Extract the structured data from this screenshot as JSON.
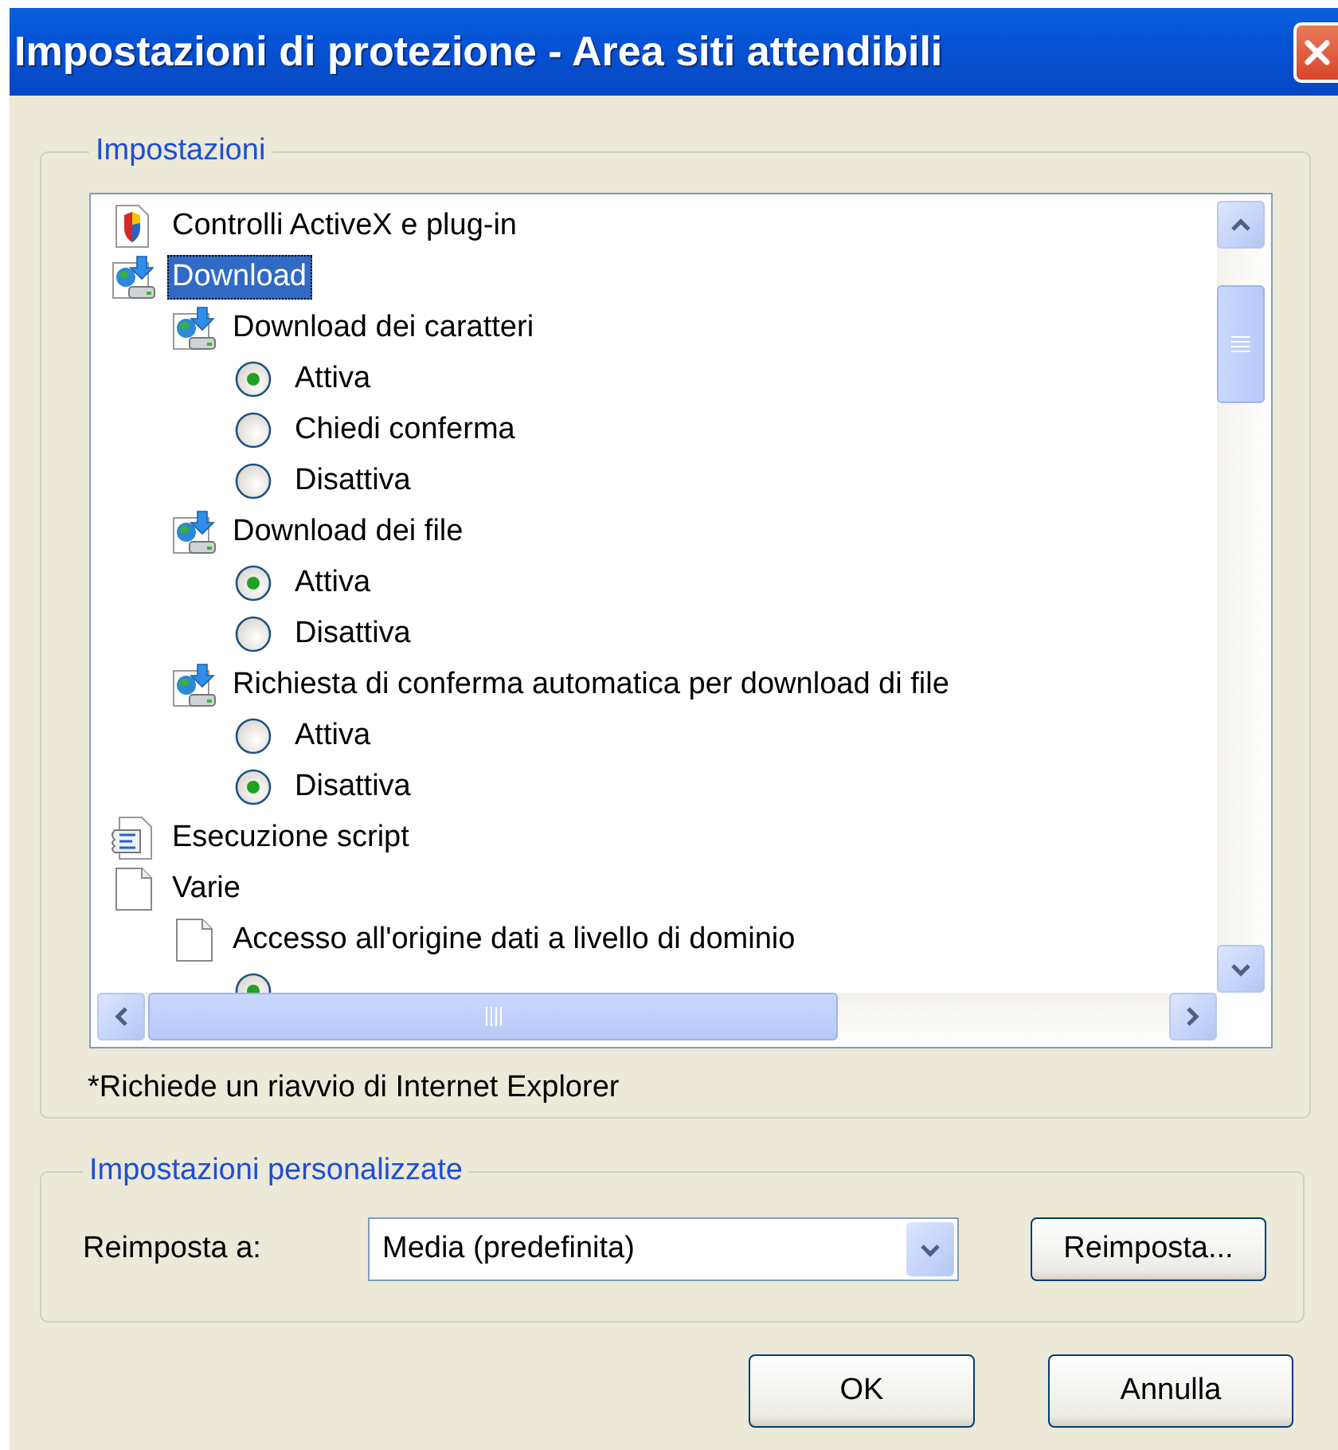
{
  "window": {
    "title": "Impostazioni di protezione - Area siti attendibili"
  },
  "settings_group": {
    "legend": "Impostazioni",
    "tree": [
      {
        "kind": "activex",
        "label": "Controlli ActiveX e plug-in",
        "selected": false
      },
      {
        "kind": "download",
        "label": "Download",
        "selected": true,
        "children": [
          {
            "kind": "download",
            "label": "Download dei caratteri",
            "selected": false,
            "children": [
              {
                "kind": "radio",
                "label": "Attiva",
                "checked": true
              },
              {
                "kind": "radio",
                "label": "Chiedi conferma",
                "checked": false
              },
              {
                "kind": "radio",
                "label": "Disattiva",
                "checked": false
              }
            ]
          },
          {
            "kind": "download",
            "label": "Download dei file",
            "selected": false,
            "children": [
              {
                "kind": "radio",
                "label": "Attiva",
                "checked": true
              },
              {
                "kind": "radio",
                "label": "Disattiva",
                "checked": false
              }
            ]
          },
          {
            "kind": "download",
            "label": "Richiesta di conferma automatica per download di file",
            "selected": false,
            "children": [
              {
                "kind": "radio",
                "label": "Attiva",
                "checked": false
              },
              {
                "kind": "radio",
                "label": "Disattiva",
                "checked": true
              }
            ]
          }
        ]
      },
      {
        "kind": "script",
        "label": "Esecuzione script",
        "selected": false
      },
      {
        "kind": "page",
        "label": "Varie",
        "selected": false,
        "children": [
          {
            "kind": "page",
            "label": "Accesso all'origine dati a livello di dominio",
            "selected": false,
            "children": [
              {
                "kind": "radio",
                "checked": true
              }
            ]
          }
        ]
      }
    ],
    "note": "*Richiede un riavvio di Internet Explorer"
  },
  "custom_group": {
    "legend": "Impostazioni personalizzate",
    "reset_label": "Reimposta a:",
    "reset_value": "Media (predefinita)",
    "reset_button": "Reimposta..."
  },
  "buttons": [
    {
      "label": "OK"
    },
    {
      "label": "Annulla"
    }
  ]
}
